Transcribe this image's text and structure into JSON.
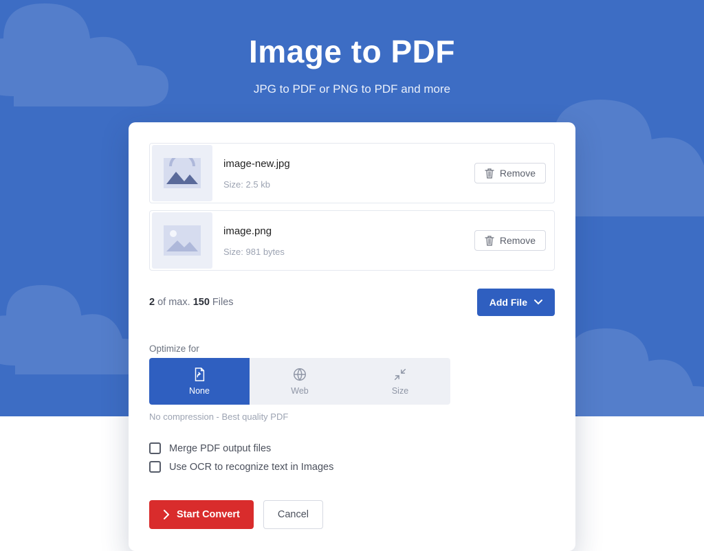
{
  "hero": {
    "title": "Image to PDF",
    "subtitle": "JPG to PDF or PNG to PDF and more"
  },
  "files": [
    {
      "name": "image-new.jpg",
      "size_label": "Size: 2.5 kb",
      "remove_label": "Remove"
    },
    {
      "name": "image.png",
      "size_label": "Size: 981 bytes",
      "remove_label": "Remove"
    }
  ],
  "count": {
    "current": "2",
    "mid": " of max. ",
    "max": "150",
    "suffix": " Files"
  },
  "add_file_label": "Add File",
  "optimize": {
    "label": "Optimize for",
    "options": [
      {
        "key": "none",
        "label": "None",
        "active": true
      },
      {
        "key": "web",
        "label": "Web",
        "active": false
      },
      {
        "key": "size",
        "label": "Size",
        "active": false
      }
    ],
    "description": "No compression - Best quality PDF"
  },
  "checks": {
    "merge": "Merge PDF output files",
    "ocr": "Use OCR to recognize text in Images"
  },
  "actions": {
    "start": "Start Convert",
    "cancel": "Cancel"
  }
}
